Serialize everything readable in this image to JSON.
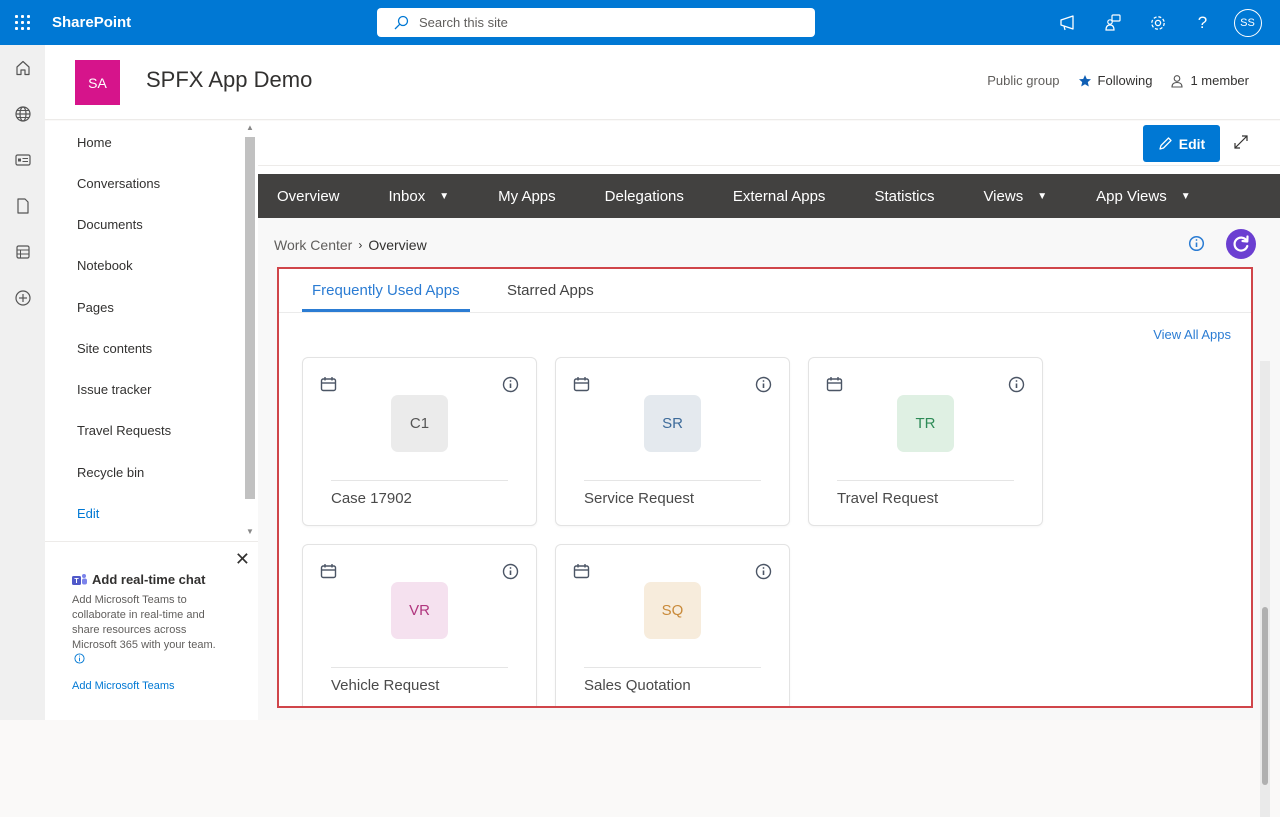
{
  "suitebar": {
    "app_name": "SharePoint",
    "search_placeholder": "Search this site",
    "icons": [
      "megaphone-icon",
      "feedback-icon",
      "settings-icon",
      "help-icon"
    ],
    "help_glyph": "?",
    "user_initials": "SS"
  },
  "appbar": {
    "items": [
      "home-icon",
      "globe-icon",
      "news-icon",
      "document-icon",
      "list-icon",
      "add-icon"
    ]
  },
  "site": {
    "logo_initials": "SA",
    "logo_color": "#d6148b",
    "title": "SPFX App Demo",
    "privacy": "Public group",
    "following_label": "Following",
    "members_label": "1 member"
  },
  "leftnav": {
    "items": [
      {
        "label": "Home"
      },
      {
        "label": "Conversations"
      },
      {
        "label": "Documents"
      },
      {
        "label": "Notebook"
      },
      {
        "label": "Pages"
      },
      {
        "label": "Site contents"
      },
      {
        "label": "Issue tracker"
      },
      {
        "label": "Travel Requests"
      },
      {
        "label": "Recycle bin"
      }
    ],
    "edit_label": "Edit"
  },
  "teams_card": {
    "title": "Add real-time chat",
    "body": "Add Microsoft Teams to collaborate in real-time and share resources across Microsoft 365 with your team.",
    "link": "Add Microsoft Teams"
  },
  "commandbar": {
    "edit_label": "Edit"
  },
  "topnav": {
    "items": [
      {
        "label": "Overview",
        "dropdown": false
      },
      {
        "label": "Inbox",
        "dropdown": true
      },
      {
        "label": "My Apps",
        "dropdown": false
      },
      {
        "label": "Delegations",
        "dropdown": false
      },
      {
        "label": "External Apps",
        "dropdown": false
      },
      {
        "label": "Statistics",
        "dropdown": false
      },
      {
        "label": "Views",
        "dropdown": true
      },
      {
        "label": "App Views",
        "dropdown": true
      }
    ],
    "caret": "▼"
  },
  "breadcrumb": {
    "root": "Work Center",
    "separator": "›",
    "current": "Overview"
  },
  "apps_panel": {
    "tabs": [
      {
        "label": "Frequently Used Apps",
        "active": true
      },
      {
        "label": "Starred Apps",
        "active": false
      }
    ],
    "view_all_label": "View All Apps",
    "accent": "#2b7cd3",
    "cards": [
      {
        "initials": "C1",
        "name": "Case 17902",
        "bg": "#ebebeb",
        "fg": "#555555"
      },
      {
        "initials": "SR",
        "name": "Service Request",
        "bg": "#e4e9ee",
        "fg": "#3d6b9a"
      },
      {
        "initials": "TR",
        "name": "Travel Request",
        "bg": "#dff0e3",
        "fg": "#2e8b57"
      },
      {
        "initials": "VR",
        "name": "Vehicle Request",
        "bg": "#f5e1ef",
        "fg": "#b0357e"
      },
      {
        "initials": "SQ",
        "name": "Sales Quotation",
        "bg": "#f7ecdc",
        "fg": "#c98a3a"
      }
    ]
  }
}
